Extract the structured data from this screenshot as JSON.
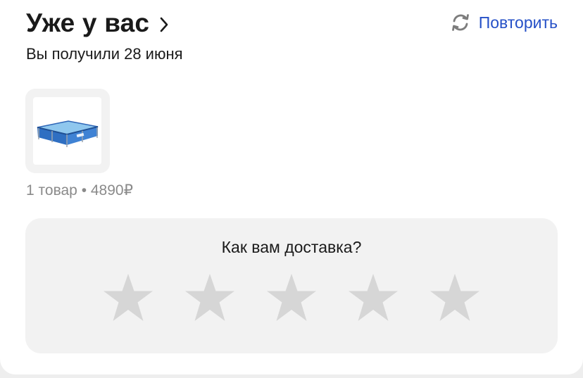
{
  "order": {
    "title": "Уже у вас",
    "subtitle": "Вы получили 28 июня",
    "repeat_label": "Повторить",
    "summary": "1 товар • 4890₽",
    "product_icon": "pool-image"
  },
  "rating": {
    "question": "Как вам доставка?",
    "max_stars": 5,
    "selected": 0,
    "star_color": "#d6d6d6"
  },
  "colors": {
    "link": "#2550c7",
    "muted": "#8a8a8a",
    "panel": "#f2f2f2"
  }
}
